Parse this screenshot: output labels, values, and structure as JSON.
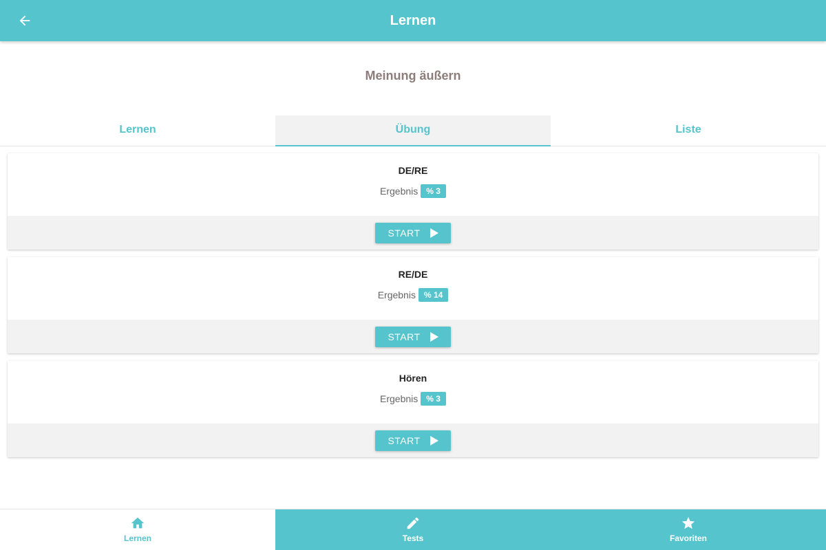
{
  "header": {
    "title": "Lernen",
    "back_icon": "arrow-left-icon"
  },
  "subtitle": "Meinung äußern",
  "tabs": [
    {
      "label": "Lernen",
      "active": false
    },
    {
      "label": "Übung",
      "active": true
    },
    {
      "label": "Liste",
      "active": false
    }
  ],
  "cards": [
    {
      "title": "DE/RE",
      "result_label": "Ergebnis",
      "result_value": "% 3",
      "start_label": "START"
    },
    {
      "title": "RE/DE",
      "result_label": "Ergebnis",
      "result_value": "% 14",
      "start_label": "START"
    },
    {
      "title": "Hören",
      "result_label": "Ergebnis",
      "result_value": "% 3",
      "start_label": "START"
    }
  ],
  "bottom_nav": [
    {
      "label": "Lernen",
      "icon": "home-icon",
      "active": true
    },
    {
      "label": "Tests",
      "icon": "pencil-icon",
      "active": false
    },
    {
      "label": "Favoriten",
      "icon": "star-icon",
      "active": false
    }
  ],
  "colors": {
    "accent": "#55c4cd",
    "subtitle": "#8d7d7a",
    "card_footer": "#f2f2f2"
  }
}
